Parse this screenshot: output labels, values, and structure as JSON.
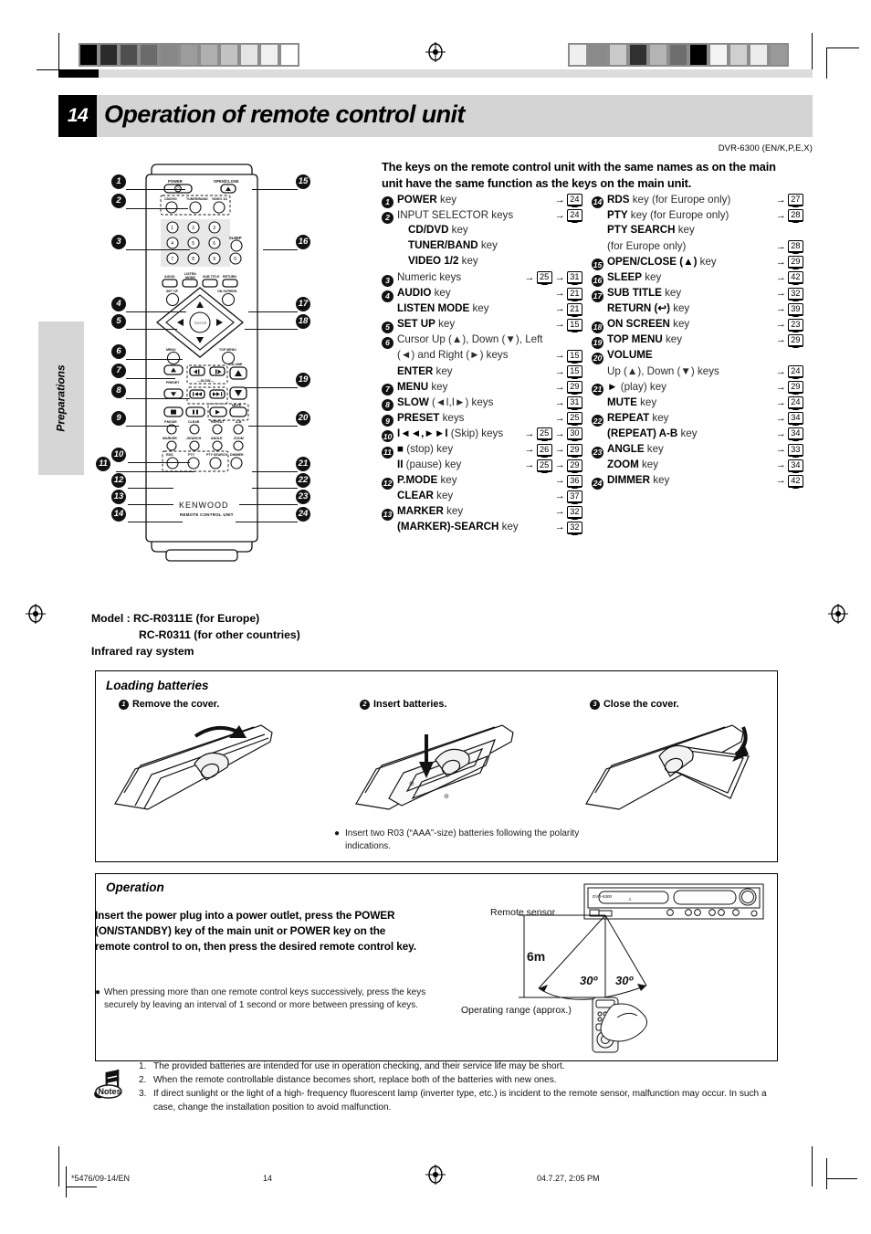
{
  "header": {
    "chapter_number": "14",
    "title": "Operation of remote control unit",
    "doc_code": "DVR-6300 (EN/K,P,E,X)",
    "side_tab": "Preparations"
  },
  "intro": "The keys on the remote control unit with the same names as on the main unit have the same function as the keys on the main unit.",
  "key_list_left": [
    {
      "num": "1",
      "bold": "POWER",
      "rest": " key",
      "refs": [
        "24"
      ]
    },
    {
      "num": "2",
      "bold": "",
      "rest": "INPUT SELECTOR keys",
      "refs": [
        "24"
      ]
    },
    {
      "num": "",
      "indent": true,
      "bold": "CD/DVD",
      "rest": " key",
      "refs": []
    },
    {
      "num": "",
      "indent": true,
      "bold": "TUNER/BAND",
      "rest": " key",
      "refs": []
    },
    {
      "num": "",
      "indent": true,
      "bold": "VIDEO 1/2",
      "rest": " key",
      "refs": []
    },
    {
      "num": "3",
      "bold": "",
      "rest": "Numeric keys",
      "refs": [
        "25",
        "31"
      ]
    },
    {
      "num": "4",
      "bold": "AUDIO",
      "rest": " key",
      "refs": [
        "21"
      ]
    },
    {
      "num": "",
      "bold": "LISTEN MODE",
      "rest": " key",
      "refs": [
        "21"
      ]
    },
    {
      "num": "5",
      "bold": "SET UP",
      "rest": " key",
      "refs": [
        "15"
      ]
    },
    {
      "num": "6",
      "bold": "",
      "rest": "Cursor Up (▲), Down (▼), Left",
      "refs": []
    },
    {
      "num": "",
      "bold": "",
      "rest": "(◄) and Right (►) keys",
      "refs": [
        "15"
      ]
    },
    {
      "num": "",
      "bold": "ENTER",
      "rest": " key",
      "refs": [
        "15"
      ]
    },
    {
      "num": "7",
      "bold": "MENU",
      "rest": " key",
      "refs": [
        "29"
      ]
    },
    {
      "num": "8",
      "bold": "SLOW",
      "rest": " (◄I,I►) keys",
      "refs": [
        "31"
      ]
    },
    {
      "num": "9",
      "bold": "PRESET",
      "rest": " keys",
      "refs": [
        "25"
      ]
    },
    {
      "num": "10",
      "bold": "I◄◄,►►I",
      "rest": " (Skip) keys",
      "refs": [
        "25",
        "30"
      ]
    },
    {
      "num": "11",
      "bold": "■",
      "rest": " (stop) key",
      "refs": [
        "26",
        "29"
      ]
    },
    {
      "num": "",
      "bold": "II",
      "rest": " (pause) key",
      "refs": [
        "25",
        "29"
      ]
    },
    {
      "num": "12",
      "bold": "P.MODE",
      "rest": " key",
      "refs": [
        "36"
      ]
    },
    {
      "num": "",
      "bold": "CLEAR",
      "rest": " key",
      "refs": [
        "37"
      ]
    },
    {
      "num": "13",
      "bold": "MARKER",
      "rest": " key",
      "refs": [
        "32"
      ]
    },
    {
      "num": "",
      "bold": "(MARKER)-SEARCH",
      "rest": " key",
      "refs": [
        "32"
      ]
    }
  ],
  "key_list_right": [
    {
      "num": "14",
      "bold": "RDS",
      "rest": " key (for Europe only)",
      "refs": [
        "27"
      ]
    },
    {
      "num": "",
      "bold": "PTY",
      "rest": " key (for Europe only)",
      "refs": [
        "28"
      ]
    },
    {
      "num": "",
      "bold": "PTY SEARCH",
      "rest": " key",
      "refs": []
    },
    {
      "num": "",
      "bold": "",
      "rest": "(for Europe only)",
      "refs": [
        "28"
      ]
    },
    {
      "num": "15",
      "bold": "OPEN/CLOSE (▲)",
      "rest": " key",
      "refs": [
        "29"
      ]
    },
    {
      "num": "16",
      "bold": "SLEEP",
      "rest": " key",
      "refs": [
        "42"
      ]
    },
    {
      "num": "17",
      "bold": "SUB TITLE",
      "rest": " key",
      "refs": [
        "32"
      ]
    },
    {
      "num": "",
      "bold": "RETURN (↩)",
      "rest": " key",
      "refs": [
        "39"
      ]
    },
    {
      "num": "18",
      "bold": "ON SCREEN",
      "rest": " key",
      "refs": [
        "23"
      ]
    },
    {
      "num": "19",
      "bold": "TOP MENU",
      "rest": " key",
      "refs": [
        "29"
      ]
    },
    {
      "num": "20",
      "bold": "VOLUME",
      "rest": "",
      "refs": []
    },
    {
      "num": "",
      "bold": "",
      "rest": "Up (▲), Down (▼) keys",
      "refs": [
        "24"
      ]
    },
    {
      "num": "21",
      "bold": "►",
      "rest": " (play) key",
      "refs": [
        "29"
      ]
    },
    {
      "num": "",
      "bold": "MUTE",
      "rest": " key",
      "refs": [
        "24"
      ]
    },
    {
      "num": "22",
      "bold": "REPEAT",
      "rest": " key",
      "refs": [
        "34"
      ]
    },
    {
      "num": "",
      "bold": "(REPEAT) A-B",
      "rest": " key",
      "refs": [
        "34"
      ]
    },
    {
      "num": "23",
      "bold": "ANGLE",
      "rest": " key",
      "refs": [
        "33"
      ]
    },
    {
      "num": "",
      "bold": "ZOOM",
      "rest": " key",
      "refs": [
        "34"
      ]
    },
    {
      "num": "24",
      "bold": "DIMMER",
      "rest": " key",
      "refs": [
        "42"
      ]
    }
  ],
  "model": {
    "line1_label": "Model :",
    "line1_value": "RC-R0311E (for Europe)",
    "line2_value": "RC-R0311 (for other countries)",
    "line3": "Infrared ray system"
  },
  "loading_batteries": {
    "title": "Loading batteries",
    "steps": [
      {
        "num": "1",
        "text": "Remove the cover."
      },
      {
        "num": "2",
        "text": "Insert batteries."
      },
      {
        "num": "3",
        "text": "Close the cover."
      }
    ],
    "note": "Insert two R03 (“AAA”-size) batteries following the polarity indications."
  },
  "operation": {
    "title": "Operation",
    "body": "Insert the power plug into a power outlet, press the POWER (ON/STANDBY) key of the main unit or POWER key on the remote control to on, then press the desired remote control key.",
    "bullet": "When pressing more than one remote control keys successively, press the keys securely by leaving an interval of 1 second or more between pressing of keys.",
    "diagram": {
      "sensor_label": "Remote sensor",
      "distance_label": "6m",
      "angle_left": "30º",
      "angle_right": "30º",
      "range_label": "Operating range (approx.)"
    }
  },
  "notes": {
    "icon_label": "Notes",
    "items": [
      {
        "num": "1.",
        "text": "The provided batteries are intended for use in operation checking, and their service life may be short."
      },
      {
        "num": "2.",
        "text": "When the remote controllable distance becomes short, replace both of the batteries with new ones."
      },
      {
        "num": "3.",
        "text": "If direct sunlight or the light of a high- frequency fluorescent lamp (inverter type, etc.) is incident to the remote sensor, malfunction may occur. In such a case, change the installation position to avoid malfunction."
      }
    ]
  },
  "footer": {
    "file": "*5476/09-14/EN",
    "page": "14",
    "date": "04.7.27, 2:05 PM"
  },
  "remote": {
    "brand": "KENWOOD",
    "brand_sub": "REMOTE CONTROL UNIT",
    "labels": {
      "power": "POWER",
      "open_close": "OPEN/CLOSE",
      "cd_dvd": "CD/DVD",
      "tuner_band": "TUNER/BAND",
      "video": "VIDEO 1/2",
      "sleep": "SLEEP",
      "audio": "AUDIO",
      "listen_mode": "LISTEN MODE",
      "sub_title": "SUB TITLE",
      "return": "RETURN",
      "set_up": "SET UP",
      "on_screen": "ON SCREEN",
      "menu": "MENU",
      "top_menu": "TOP MENU",
      "enter": "ENTER",
      "slow": "SLOW",
      "preset": "PRESET",
      "volume": "VOLUME",
      "mute": "MUTE",
      "p_mode": "P.MODE",
      "clear": "CLEAR",
      "repeat": "REPEAT",
      "ab": "A-B",
      "marker": "MARKER",
      "search": "SEARCH",
      "angle": "ANGLE",
      "zoom": "ZOOM",
      "rds": "RDS",
      "pty": "PTY",
      "pty_search": "PTY SEARCH",
      "dimmer": "DIMMER"
    },
    "numeric_keys": [
      "1",
      "2",
      "3",
      "4",
      "5",
      "6",
      "7",
      "8",
      "9",
      "0"
    ],
    "callouts_left": [
      "1",
      "2",
      "3",
      "4",
      "5",
      "6",
      "7",
      "8",
      "9",
      "10",
      "11",
      "12",
      "13",
      "14"
    ],
    "callouts_right": [
      "15",
      "16",
      "17",
      "18",
      "19",
      "20",
      "21",
      "22",
      "23",
      "24"
    ]
  },
  "registration": {
    "left_swatches": [
      "#000000",
      "#2b2b2b",
      "#4f4f4f",
      "#6b6b6b",
      "#878787",
      "#9c9c9c",
      "#b0b0b0",
      "#c2c2c2",
      "#e4e4e4",
      "#f0f0f0",
      "#ffffff"
    ],
    "right_swatches": [
      "#efefef",
      "#8a8a8a",
      "#c9c9c9",
      "#303030",
      "#b4b4b4",
      "#6e6e6e",
      "#000000",
      "#f4f4f4",
      "#cfcfcf",
      "#ececec",
      "#9a9a9a"
    ]
  }
}
